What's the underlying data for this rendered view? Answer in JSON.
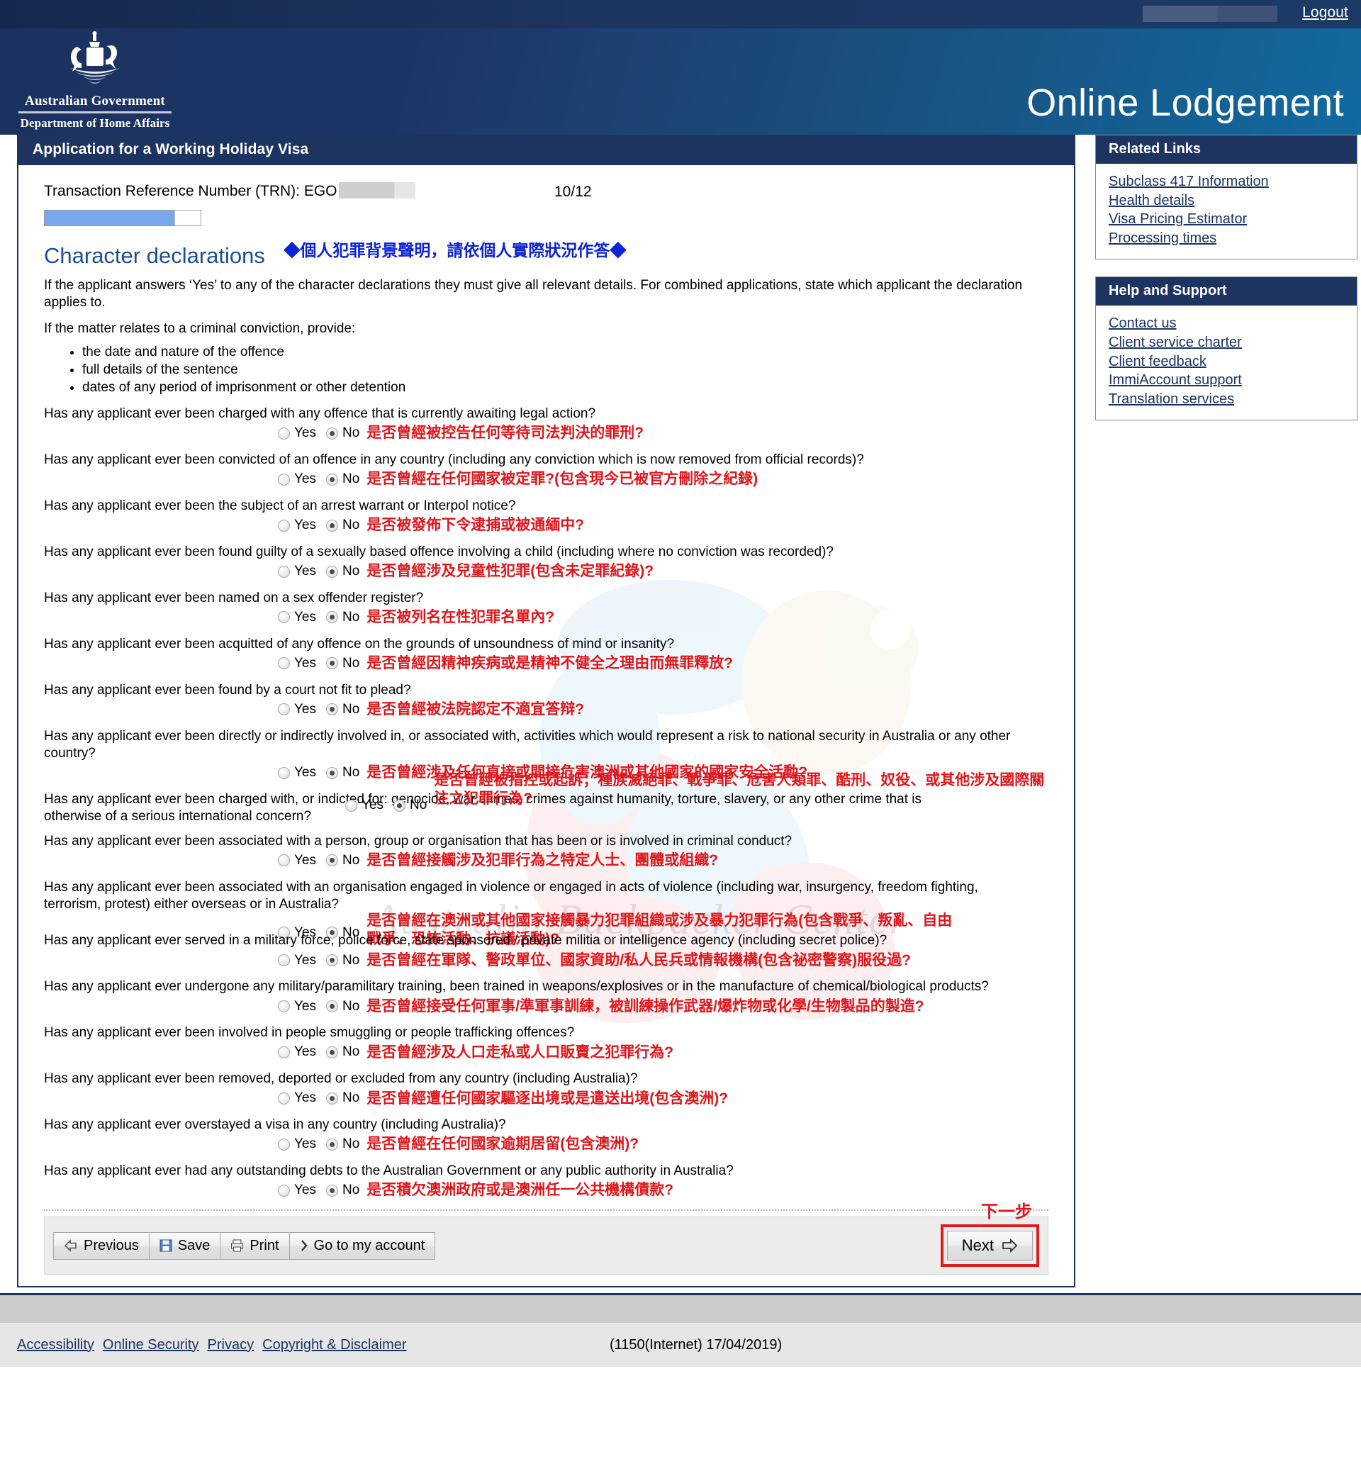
{
  "topbar": {
    "logout_label": "Logout",
    "user_redacted": true
  },
  "banner": {
    "crest_gov": "Australian Government",
    "crest_dept": "Department of Home Affairs",
    "title": "Online Lodgement"
  },
  "main": {
    "panel_title": "Application for a Working Holiday Visa",
    "trn_label": "Transaction Reference Number (TRN): EGO",
    "page_count": "10/12",
    "progress_percent": 83,
    "section_title": "Character declarations",
    "section_title_cn": "◆個人犯罪背景聲明，請依個人實際狀況作答◆",
    "intro_1": "If the applicant answers ‘Yes’ to any of the character declarations they must give all relevant details. For combined applications, state which applicant the declaration applies to.",
    "intro_2": "If the matter relates to a criminal conviction, provide:",
    "bullets": [
      "the date and nature of the offence",
      "full details of the sentence",
      "dates of any period of imprisonment or other detention"
    ],
    "yes_label": "Yes",
    "no_label": "No",
    "questions": [
      {
        "text": "Has any applicant ever been charged with any offence that is currently awaiting legal action?",
        "cn": "是否曾經被控告任何等待司法判決的罪刑?",
        "answer": "No"
      },
      {
        "text": "Has any applicant ever been convicted of an offence in any country (including any conviction which is now removed from official records)?",
        "cn": "是否曾經在任何國家被定罪?(包含現今已被官方刪除之紀錄)",
        "answer": "No"
      },
      {
        "text": "Has any applicant ever been the subject of an arrest warrant or Interpol notice?",
        "cn": "是否被發佈下令逮捕或被通緬中?",
        "answer": "No"
      },
      {
        "text": "Has any applicant ever been found guilty of a sexually based offence involving a child (including where no conviction was recorded)?",
        "cn": "是否曾經涉及兒童性犯罪(包含未定罪紀錄)?",
        "answer": "No"
      },
      {
        "text": "Has any applicant ever been named on a sex offender register?",
        "cn": "是否被列名在性犯罪名單內?",
        "answer": "No"
      },
      {
        "text": "Has any applicant ever been acquitted of any offence on the grounds of unsoundness of mind or insanity?",
        "cn": "是否曾經因精神疾病或是精神不健全之理由而無罪釋放?",
        "answer": "No"
      },
      {
        "text": "Has any applicant ever been found by a court not fit to plead?",
        "cn": "是否曾經被法院認定不適宜答辩?",
        "answer": "No"
      },
      {
        "text": "Has any applicant ever been directly or indirectly involved in, or associated with, activities which would represent a risk to national security in Australia or any other country?",
        "cn": "是否曾經涉及任何直接或間接危害澳洲或其他國家的國家安全活動?",
        "answer": "No"
      },
      {
        "text": "Has any applicant ever been charged with, or indicted for: genocide, war crimes, crimes against humanity, torture, slavery, or any other crime that is otherwise of a serious international concern?",
        "cn": "是否曾經被指控或起訴；種族滅絕罪、戰爭罪、危害人類罪、酷刑、奴役、或其他涉及國際關注之犯罪行為?",
        "answer": "No"
      },
      {
        "text": "Has any applicant ever been associated with a person, group or organisation that has been or is involved in criminal conduct?",
        "cn": "是否曾經接觸涉及犯罪行為之特定人士、團體或組織?",
        "answer": "No"
      },
      {
        "text": "Has any applicant ever been associated with an organisation engaged in violence or engaged in acts of violence (including war, insurgency, freedom fighting, terrorism, protest) either overseas or in Australia?",
        "cn": "是否曾經在澳洲或其他國家接觸暴力犯罪組織或涉及暴力犯罪行為(包含戰爭、叛亂、自由戰爭、恐怖活動、抗議活動)?",
        "answer": "No"
      },
      {
        "text": "Has any applicant ever served in a military force, police force, state sponsored / private militia or intelligence agency (including secret police)?",
        "cn": "是否曾經在軍隊、警政單位、國家資助/私人民兵或情報機構(包含祕密警察)服役過?",
        "answer": "No"
      },
      {
        "text": "Has any applicant ever undergone any military/paramilitary training, been trained in weapons/explosives or in the manufacture of chemical/biological products?",
        "cn": "是否曾經接受任何軍事/準軍事訓練，被訓練操作武器/爆炸物或化學/生物製品的製造?",
        "answer": "No"
      },
      {
        "text": "Has any applicant ever been involved in people smuggling or people trafficking offences?",
        "cn": "是否曾經涉及人口走私或人口販賣之犯罪行為?",
        "answer": "No"
      },
      {
        "text": "Has any applicant ever been removed, deported or excluded from any country (including Australia)?",
        "cn": "是否曾經遭任何國家驅逐出境或是遣送出境(包含澳洲)?",
        "answer": "No"
      },
      {
        "text": "Has any applicant ever overstayed a visa in any country (including Australia)?",
        "cn": "是否曾經在任何國家逾期居留(包含澳洲)?",
        "answer": "No"
      },
      {
        "text": "Has any applicant ever had any outstanding debts to the Australian Government or any public authority in Australia?",
        "cn": "是否積欠澳洲政府或是澳洲任一公共機構債款?",
        "answer": "No"
      }
    ]
  },
  "buttons": {
    "previous": "Previous",
    "save": "Save",
    "print": "Print",
    "account": "Go to my account",
    "next": "Next",
    "next_cn": "下一步"
  },
  "sidebar": {
    "related_links": {
      "title": "Related Links",
      "items": [
        "Subclass 417 Information",
        "Health details",
        "Visa Pricing Estimator",
        "Processing times"
      ]
    },
    "help_support": {
      "title": "Help and Support",
      "items": [
        "Contact us",
        "Client service charter",
        "Client feedback",
        "ImmiAccount support",
        "Translation services"
      ]
    }
  },
  "footer": {
    "links": [
      "Accessibility",
      "Online Security",
      "Privacy",
      "Copyright & Disclaimer"
    ],
    "build": "(1150(Internet) 17/04/2019)"
  },
  "colors": {
    "navy": "#1d3461",
    "banner_blue": "#11699f",
    "heading_blue": "#1b4f91",
    "annotation_red": "#e0161b",
    "annotation_blue": "#0b23d8",
    "progress_blue": "#7aa7ec",
    "highlight_border": "#e01b1b"
  },
  "watermark_text": "Australia Backpacker Center"
}
